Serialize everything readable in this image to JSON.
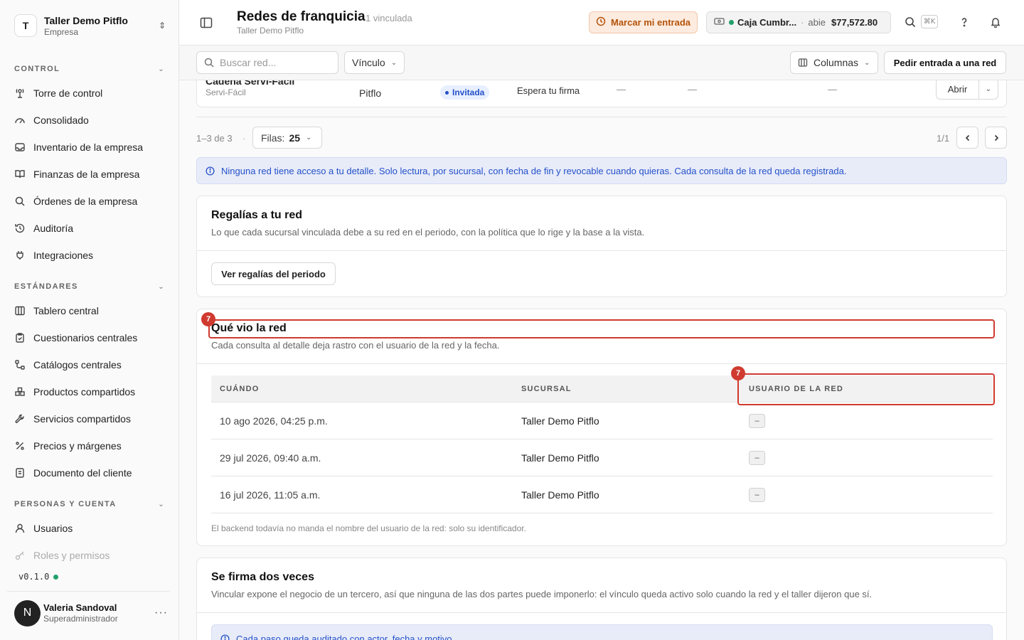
{
  "sidebar": {
    "company": {
      "initial": "T",
      "name": "Taller Demo Pitflo",
      "type": "Empresa"
    },
    "sections": [
      {
        "title": "CONTROL",
        "items": [
          "Torre de control",
          "Consolidado",
          "Inventario de la empresa",
          "Finanzas de la empresa",
          "Órdenes de la empresa",
          "Auditoría",
          "Integraciones"
        ]
      },
      {
        "title": "ESTÁNDARES",
        "items": [
          "Tablero central",
          "Cuestionarios centrales",
          "Catálogos centrales",
          "Productos compartidos",
          "Servicios compartidos",
          "Precios y márgenes",
          "Documento del cliente"
        ]
      },
      {
        "title": "PERSONAS Y CUENTA",
        "items": [
          "Usuarios",
          "Roles y permisos"
        ]
      }
    ],
    "version": "v0.1.0",
    "user": {
      "initial": "N",
      "name": "Valeria Sandoval",
      "role": "Superadministrador"
    }
  },
  "header": {
    "title": "Redes de franquicia",
    "linked_count": "1 vinculada",
    "subtitle": "Taller Demo Pitflo",
    "entry_button": "Marcar mi entrada",
    "cash": {
      "name": "Caja Cumbr...",
      "separator": "·",
      "state": "abie",
      "amount": "$77,572.80"
    },
    "shortcut": "⌘K"
  },
  "toolbar": {
    "search_placeholder": "Buscar red...",
    "filter_label": "Vínculo",
    "columns_label": "Columnas",
    "request_button": "Pedir entrada a una red"
  },
  "network_row": {
    "name": "Cadena Servi-Fácil",
    "short": "Servi-Fácil",
    "owner": "Pitflo",
    "status_pill": "Invitada",
    "status": "Espera tu firma",
    "dash": "—",
    "open_button": "Abrir"
  },
  "pagination": {
    "range": "1–3 de 3",
    "dot": "·",
    "rows_label": "Filas:",
    "rows_value": "25",
    "page": "1/1"
  },
  "info_banner": "Ninguna red tiene acceso a tu detalle. Solo lectura, por sucursal, con fecha de fin y revocable cuando quieras. Cada consulta de la red queda registrada.",
  "royalties": {
    "title": "Regalías a tu red",
    "description": "Lo que cada sucursal vinculada debe a su red en el periodo, con la política que lo rige y la base a la vista.",
    "button": "Ver regalías del periodo"
  },
  "seen": {
    "title": "Qué vio la red",
    "description": "Cada consulta al detalle deja rastro con el usuario de la red y la fecha.",
    "columns": [
      "CUÁNDO",
      "SUCURSAL",
      "USUARIO DE LA RED"
    ],
    "rows": [
      {
        "when": "10 ago 2026, 04:25 p.m.",
        "branch": "Taller Demo Pitflo",
        "user": "–"
      },
      {
        "when": "29 jul 2026, 09:40 a.m.",
        "branch": "Taller Demo Pitflo",
        "user": "–"
      },
      {
        "when": "16 jul 2026, 11:05 a.m.",
        "branch": "Taller Demo Pitflo",
        "user": "–"
      }
    ],
    "note": "El backend todavía no manda el nombre del usuario de la red: solo su identificador.",
    "highlight_badge": "7"
  },
  "sign_twice": {
    "title": "Se firma dos veces",
    "description": "Vincular expone el negocio de un tercero, así que ninguna de las dos partes puede imponerlo: el vínculo queda activo solo cuando la red y el taller dijeron que sí.",
    "banner": "Cada paso queda auditado con actor, fecha y motivo."
  },
  "colors": {
    "accent_blue": "#2451c9",
    "highlight_red": "#d03a2f",
    "status_green": "#22a06b",
    "entry_orange": "#b45309"
  }
}
